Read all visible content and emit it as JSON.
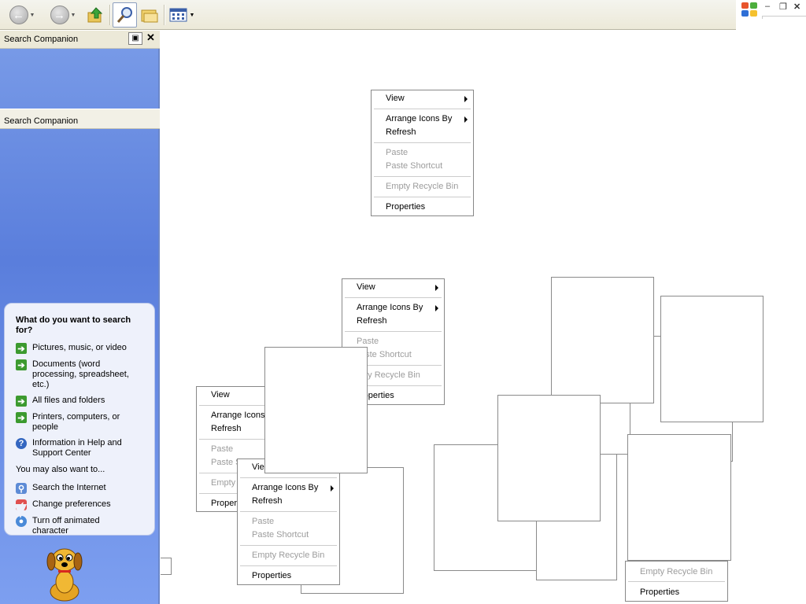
{
  "toolbar": {
    "back_icon": "back-arrow-icon",
    "forward_icon": "forward-arrow-icon",
    "up_icon": "up-folder-icon",
    "search_icon": "search-magnifier-icon",
    "folders_icon": "folders-icon",
    "views_icon": "views-icon"
  },
  "search_pane": {
    "header_title": "Search Companion",
    "subheader_title": "Search Companion",
    "question": "What do you want to search for?",
    "options": [
      "Pictures, music, or video",
      "Documents (word processing, spreadsheet, etc.)",
      "All files and folders",
      "Printers, computers, or people",
      "Information in Help and Support Center"
    ],
    "also_label": "You may also want to...",
    "also_options": [
      "Search the Internet",
      "Change preferences",
      "Turn off animated character"
    ]
  },
  "context_menu": {
    "view": "View",
    "arrange": "Arrange Icons By",
    "refresh": "Refresh",
    "paste": "Paste",
    "paste_shortcut": "Paste Shortcut",
    "empty_recycle": "Empty Recycle Bin",
    "properties": "Properties"
  },
  "partial_menus": {
    "m3_view": "View",
    "m3_arrange": "Arrange Icons",
    "m3_refresh": "Refresh",
    "m3_paste": "Paste",
    "m3_paste_shortcut": "Paste S",
    "m3_empty": "Empty",
    "m3_properties": "Proper",
    "m2_view": "View",
    "m2_arrange": "Arrange Icons By",
    "m2_refresh": "Refresh",
    "m2_paste": "Paste",
    "m2_paste_shortcut": "aste Shortcut",
    "m2_empty": "pty Recycle Bin",
    "m2_properties": "roperties",
    "m4_view": "Vie",
    "m5_empty": "Empty Recycle Bin",
    "m5_properties": "Properties"
  },
  "colors": {
    "pane_blue": "#6f90e4",
    "bubble": "#eef1fb",
    "disabled_text": "#9c9c9c"
  }
}
